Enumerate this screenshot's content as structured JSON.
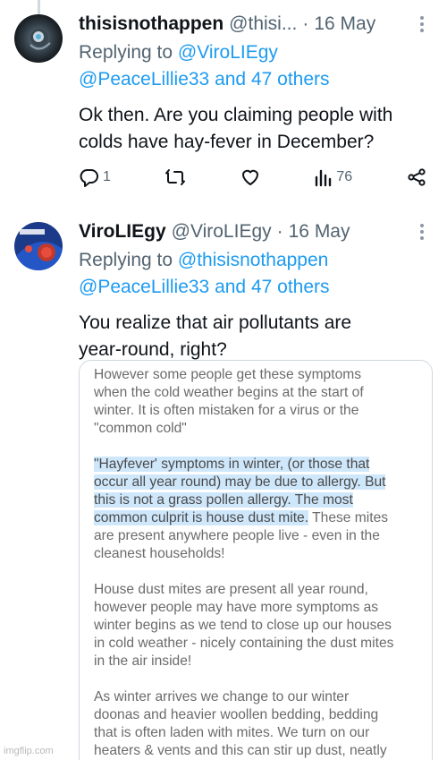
{
  "tweets": [
    {
      "name": "thisisnothappen",
      "handle": "@thisi...",
      "sep": "·",
      "date": "16 May",
      "replying_label": "Replying to",
      "reply_mentions_1": "@ViroLIEgy",
      "reply_mentions_2": "@PeaceLillie33 and 47 others",
      "text_line_1": "Ok then. Are you claiming people with",
      "text_line_2": "colds have hay-fever in December?",
      "replies": "1",
      "views": "76"
    },
    {
      "name": "ViroLIEgy",
      "handle": "@ViroLIEgy",
      "sep": "·",
      "date": "16 May",
      "replying_label": "Replying to",
      "reply_mentions_1": "@thisisnothappen",
      "reply_mentions_2": "@PeaceLillie33 and 47 others",
      "text_line_1": "You realize that air pollutants are",
      "text_line_2": "year-round, right?"
    }
  ],
  "attached_image": {
    "lines": [
      "However some people get these symptoms",
      "when the cold weather begins at the start of",
      "winter.  It is often mistaken for a virus or the",
      "\"common cold\"",
      "\"Hayfever' symptoms in winter, (or those that",
      "occur all year round) may be due to  allergy.  But",
      "this is not a grass pollen allergy.  The most",
      "common culprit is house dust mite.",
      " These mites",
      "are present anywhere people live - even in the",
      "cleanest households!",
      "House dust mites are present all year round,",
      " however people may have more symptoms as",
      "winter begins as we tend to close up our houses",
      "in cold weather - nicely containing the dust mites",
      "in the air inside!",
      "As winter arrives we change to our winter",
      "doonas and heavier woollen bedding, bedding",
      "that is often laden with mites. We turn on our",
      "heaters & vents and this can stir up dust, neatly"
    ]
  },
  "watermark": "imgflip.com",
  "colors": {
    "link": "#1d9bf0",
    "muted": "#536471",
    "highlight": "#cfe7fb"
  },
  "icons": [
    "reply-icon",
    "retweet-icon",
    "like-icon",
    "views-icon",
    "share-icon",
    "more-icon"
  ]
}
